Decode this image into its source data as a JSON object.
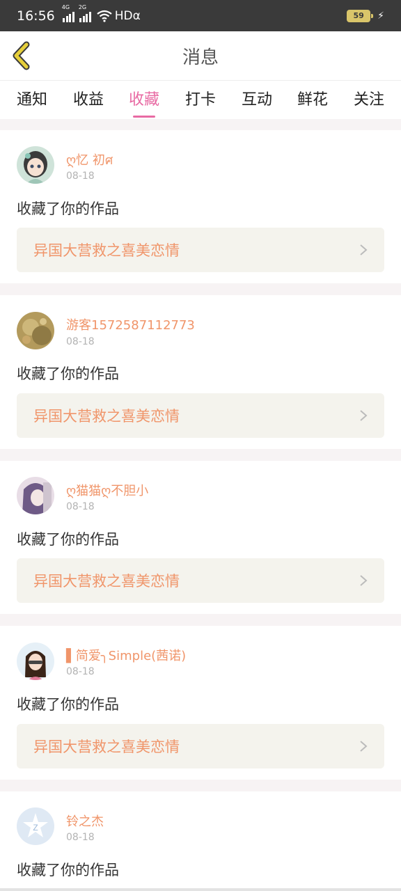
{
  "status_bar": {
    "time": "16:56",
    "net1": "4G",
    "net2": "2G",
    "hd": "HDα",
    "battery": "59"
  },
  "header": {
    "title": "消息"
  },
  "tabs": [
    {
      "label": "通知",
      "active": false
    },
    {
      "label": "收益",
      "active": false
    },
    {
      "label": "收藏",
      "active": true
    },
    {
      "label": "打卡",
      "active": false
    },
    {
      "label": "互动",
      "active": false
    },
    {
      "label": "鲜花",
      "active": false
    },
    {
      "label": "关注",
      "active": false
    }
  ],
  "messages": [
    {
      "name": "ღ忆 初ศ",
      "date": "08-18",
      "action": "收藏了你的作品",
      "work": "异国大营救之喜美恋情"
    },
    {
      "name": "游客1572587112773",
      "date": "08-18",
      "action": "收藏了你的作品",
      "work": "异国大营救之喜美恋情"
    },
    {
      "name": "ღ猫猫ღ不胆小",
      "date": "08-18",
      "action": "收藏了你的作品",
      "work": "异国大营救之喜美恋情"
    },
    {
      "name": "▌简爱╮Simple(茜诺)",
      "date": "08-18",
      "action": "收藏了你的作品",
      "work": "异国大营救之喜美恋情"
    },
    {
      "name": "铃之杰",
      "date": "08-18",
      "action": "收藏了你的作品"
    }
  ],
  "colors": {
    "accent": "#e86aa3",
    "name": "#f0956a",
    "back": "#e6cf3a"
  }
}
